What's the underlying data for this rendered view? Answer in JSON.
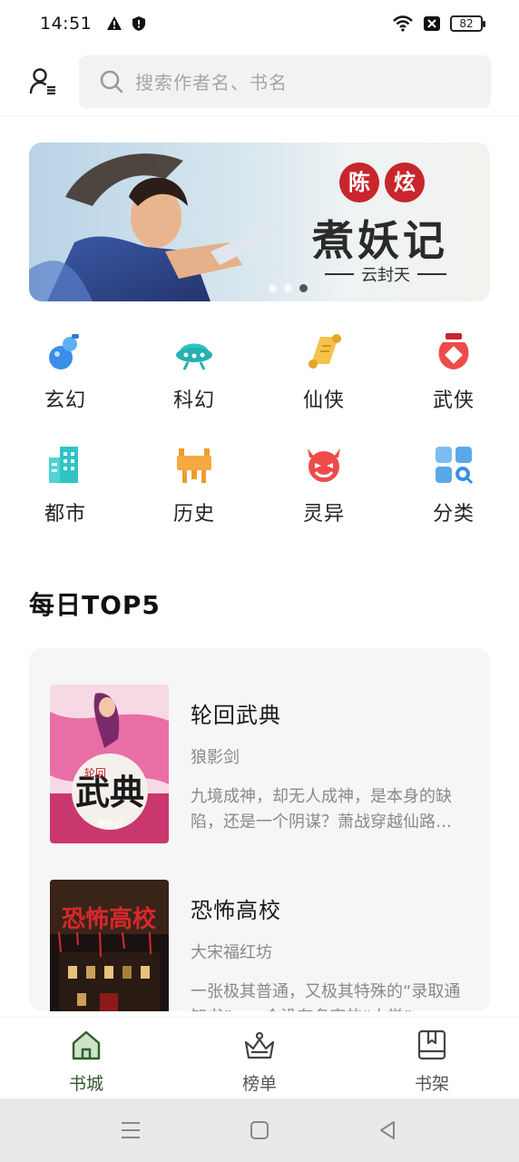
{
  "status_bar": {
    "time": "14:51",
    "battery": "82"
  },
  "header": {
    "search_placeholder": "搜索作者名、书名"
  },
  "banner": {
    "tag": "陈炫",
    "title": "煮妖记",
    "subtitle": "云封天"
  },
  "categories": [
    {
      "label": "玄幻",
      "icon": "gourd-icon",
      "color": "#3a8ee6"
    },
    {
      "label": "科幻",
      "icon": "ufo-icon",
      "color": "#2ec4c4"
    },
    {
      "label": "仙侠",
      "icon": "scroll-icon",
      "color": "#f2b233"
    },
    {
      "label": "武侠",
      "icon": "wine-jar-icon",
      "color": "#ef4a4a"
    },
    {
      "label": "都市",
      "icon": "building-icon",
      "color": "#2ec4c4"
    },
    {
      "label": "历史",
      "icon": "ding-vessel-icon",
      "color": "#f29a2e"
    },
    {
      "label": "灵异",
      "icon": "devil-icon",
      "color": "#ef4a4a"
    },
    {
      "label": "分类",
      "icon": "grid-search-icon",
      "color": "#5aa9e6"
    }
  ],
  "section": {
    "title": "每日TOP5"
  },
  "books": [
    {
      "title": "轮回武典",
      "author": "狼影剑",
      "desc": "九境成神，却无人成神，是本身的缺陷，还是一个阴谋？萧战穿越仙路…",
      "cover_text": "武典",
      "cover_side": "轮回",
      "cover_author": "狼影剑"
    },
    {
      "title": "恐怖高校",
      "author": "大宋福红坊",
      "desc": "一张极其普通，又极其特殊的“录取通知书”，一个没有名字的“大学”…",
      "cover_text": "恐怖高校"
    }
  ],
  "bottom_nav": [
    {
      "label": "书城",
      "icon": "home-icon",
      "active": true
    },
    {
      "label": "榜单",
      "icon": "crown-icon",
      "active": false
    },
    {
      "label": "书架",
      "icon": "bookshelf-icon",
      "active": false
    }
  ],
  "colors": {
    "accent": "#2f5d2a",
    "search_bg": "#f2f2f2",
    "card_bg": "#f6f6f6"
  }
}
